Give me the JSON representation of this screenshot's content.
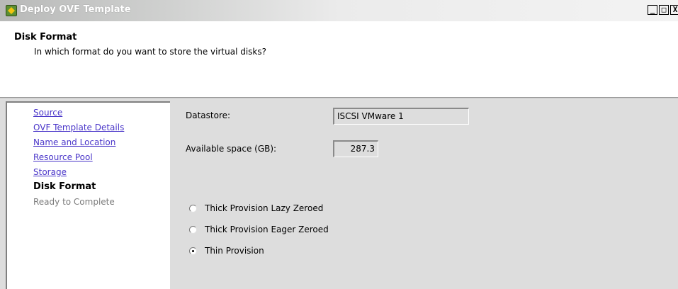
{
  "window": {
    "title": "Deploy OVF Template",
    "controls": {
      "minimize": "_",
      "maximize": "□",
      "close": "X"
    }
  },
  "header": {
    "title": "Disk Format",
    "subtitle": "In which format do you want to store the virtual disks?"
  },
  "sidebar": {
    "items": [
      {
        "label": "Source",
        "state": "link"
      },
      {
        "label": "OVF Template Details",
        "state": "link"
      },
      {
        "label": "Name and Location",
        "state": "link"
      },
      {
        "label": "Resource Pool",
        "state": "link"
      },
      {
        "label": "Storage",
        "state": "link"
      },
      {
        "label": "Disk Format",
        "state": "current"
      },
      {
        "label": "Ready to Complete",
        "state": "disabled"
      }
    ]
  },
  "form": {
    "datastore_label": "Datastore:",
    "datastore_value": "ISCSI VMware 1",
    "space_label": "Available space (GB):",
    "space_value": "287.3"
  },
  "provisioning": {
    "options": [
      {
        "label": "Thick Provision Lazy Zeroed",
        "checked": false
      },
      {
        "label": "Thick Provision Eager Zeroed",
        "checked": false
      },
      {
        "label": "Thin Provision",
        "checked": true
      }
    ]
  },
  "colors": {
    "link": "#4a36c9",
    "panel_background": "#dddddd",
    "title_text": "#ffffff"
  }
}
